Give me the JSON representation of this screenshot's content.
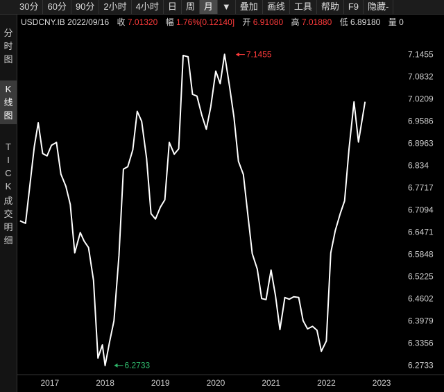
{
  "toolbar": {
    "buttons": [
      "30分",
      "60分",
      "90分",
      "2小时",
      "4小时",
      "日",
      "周",
      "月",
      "▼",
      "叠加",
      "画线",
      "工具",
      "帮助",
      "F9",
      "隐藏-"
    ],
    "active": "月"
  },
  "sidebar": {
    "tabs": [
      {
        "label": "分时图",
        "active": false
      },
      {
        "label": "K线图",
        "active": true
      },
      {
        "label": "TICK",
        "active": false
      },
      {
        "label": "成交明细",
        "active": false
      }
    ]
  },
  "info": {
    "symbol": "USDCNY.IB",
    "date": "2022/09/16",
    "close_label": "收",
    "close": "7.01320",
    "change_label": "幅",
    "change_pct": "1.76%",
    "change_abs": "[0.12140]",
    "open_label": "开",
    "open": "6.91080",
    "high_label": "高",
    "high": "7.01880",
    "low_label": "低",
    "low": "6.89180",
    "volume_label": "量",
    "volume": "0"
  },
  "colors": {
    "background": "#000000",
    "line": "#ffffff",
    "up": "#ff3b3b",
    "down": "#2fb86b",
    "grid": "#1e1e1e",
    "text": "#cccccc"
  },
  "chart_data": {
    "type": "line",
    "xlabel": "",
    "ylabel": "",
    "xlim": [
      2016.4,
      2023.5
    ],
    "ylim": [
      6.2475,
      7.1778
    ],
    "x_ticks": [
      2017,
      2018,
      2019,
      2020,
      2021,
      2022,
      2023
    ],
    "x_tick_labels": [
      "2017",
      "2018",
      "2019",
      "2020",
      "2021",
      "2022",
      "2023"
    ],
    "y_tick_labels": [
      "7.1455",
      "7.0832",
      "7.0209",
      "6.9586",
      "6.8963",
      "6.834",
      "6.7717",
      "6.7094",
      "6.6471",
      "6.5848",
      "6.5225",
      "6.4602",
      "6.3979",
      "6.3356",
      "6.2733"
    ],
    "grid": false,
    "series": [
      {
        "values_x": [
          2016.46,
          2016.56,
          2016.72,
          2016.79,
          2016.87,
          2016.95,
          2017.03,
          2017.12,
          2017.2,
          2017.29,
          2017.37,
          2017.45,
          2017.55,
          2017.62,
          2017.7,
          2017.79,
          2017.87,
          2017.95,
          2018.0,
          2018.08,
          2018.16,
          2018.25,
          2018.33,
          2018.41,
          2018.5,
          2018.58,
          2018.66,
          2018.75,
          2018.83,
          2018.91,
          2019.0,
          2019.08,
          2019.16,
          2019.25,
          2019.33,
          2019.41,
          2019.5,
          2019.58,
          2019.66,
          2019.75,
          2019.83,
          2019.91,
          2020.0,
          2020.08,
          2020.16,
          2020.25,
          2020.33,
          2020.41,
          2020.5,
          2020.58,
          2020.66,
          2020.75,
          2020.83,
          2020.91,
          2021.0,
          2021.08,
          2021.16,
          2021.25,
          2021.33,
          2021.41,
          2021.5,
          2021.58,
          2021.66,
          2021.75,
          2021.83,
          2021.91,
          2022.0,
          2022.08,
          2022.16,
          2022.25,
          2022.33,
          2022.41,
          2022.5,
          2022.58,
          2022.7
        ],
        "values_y": [
          6.679,
          6.672,
          6.888,
          6.954,
          6.868,
          6.861,
          6.891,
          6.899,
          6.81,
          6.776,
          6.725,
          6.589,
          6.646,
          6.622,
          6.604,
          6.512,
          6.294,
          6.331,
          6.273,
          6.339,
          6.399,
          6.582,
          6.824,
          6.831,
          6.878,
          6.986,
          6.958,
          6.854,
          6.699,
          6.684,
          6.718,
          6.738,
          6.899,
          6.866,
          6.881,
          7.143,
          7.139,
          7.034,
          7.029,
          6.974,
          6.936,
          6.999,
          7.099,
          7.064,
          7.146,
          7.056,
          6.969,
          6.846,
          6.809,
          6.697,
          6.587,
          6.544,
          6.461,
          6.458,
          6.541,
          6.469,
          6.374,
          6.464,
          6.459,
          6.466,
          6.464,
          6.399,
          6.376,
          6.383,
          6.372,
          6.313,
          6.342,
          6.589,
          6.651,
          6.699,
          6.735,
          6.881,
          7.013,
          6.9,
          7.0132
        ]
      }
    ],
    "annotations": [
      {
        "type": "max",
        "x": 2020.35,
        "y": 7.1455,
        "label": "7.1455"
      },
      {
        "type": "min",
        "x": 2018.15,
        "y": 6.2733,
        "label": "6.2733"
      }
    ]
  }
}
